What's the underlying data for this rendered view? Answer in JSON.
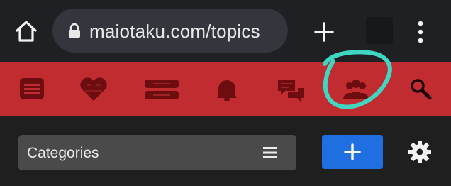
{
  "browser": {
    "url": "maiotaku.com/topics"
  },
  "site_nav": {
    "items": [
      {
        "icon": "list-icon"
      },
      {
        "icon": "heart-icon"
      },
      {
        "icon": "categories-icon"
      },
      {
        "icon": "bell-icon"
      },
      {
        "icon": "chat-icon"
      },
      {
        "icon": "users-icon"
      },
      {
        "icon": "search-icon"
      }
    ],
    "highlighted_item": "users-icon"
  },
  "colors": {
    "browser_bar": "#1f2023",
    "url_pill": "#33373d",
    "nav_bar": "#c02c30",
    "nav_icon": "#6e0d10",
    "annotation": "#3fd6c2",
    "select_bg": "#4a4a4a",
    "primary_button": "#1f6fe0"
  },
  "controls": {
    "category_select": {
      "label": "Categories"
    },
    "new_topic_button": {
      "icon": "plus-icon"
    },
    "settings_button": {
      "icon": "gear-icon"
    }
  }
}
